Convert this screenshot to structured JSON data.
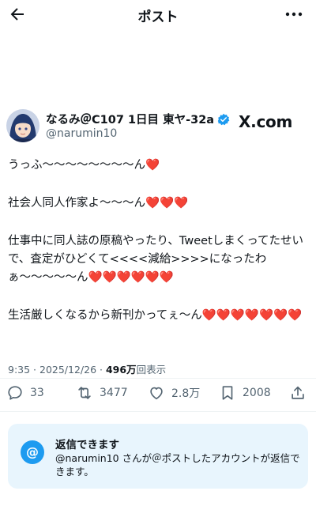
{
  "header": {
    "title": "ポスト"
  },
  "author": {
    "display_name": "なるみ＠C107 1日目 東ヤ-32a",
    "handle": "@narumin10",
    "verified_color": "#1d9bf0"
  },
  "brand": "X.com",
  "tweet": {
    "paragraphs": [
      "うっふ〜〜〜〜〜〜〜〜ん❤️",
      "社会人同人作家よ〜〜〜ん❤️❤️❤️",
      "仕事中に同人誌の原稿やったり、Tweetしまくってたせいで、査定がひどくて<<<<減給>>>>になったわぁ〜〜〜〜〜ん❤️❤️❤️❤️❤️❤️",
      "生活厳しくなるから新刊かってぇ〜ん❤️❤️❤️❤️❤️❤️❤️"
    ]
  },
  "meta": {
    "time": "9:35 · 2025/12/26 · ",
    "views_count": "496万",
    "views_label": "回表示"
  },
  "actions": {
    "replies": "33",
    "reposts": "3477",
    "likes": "2.8万",
    "bookmarks": "2008"
  },
  "reply_restriction": {
    "icon_glyph": "@",
    "title": "返信できます",
    "description": "@narumin10 さんが＠ポストしたアカウントが返信できます。"
  },
  "colors": {
    "accent": "#1d9bf0",
    "muted": "#536471",
    "card_bg": "#e8f5fd"
  }
}
